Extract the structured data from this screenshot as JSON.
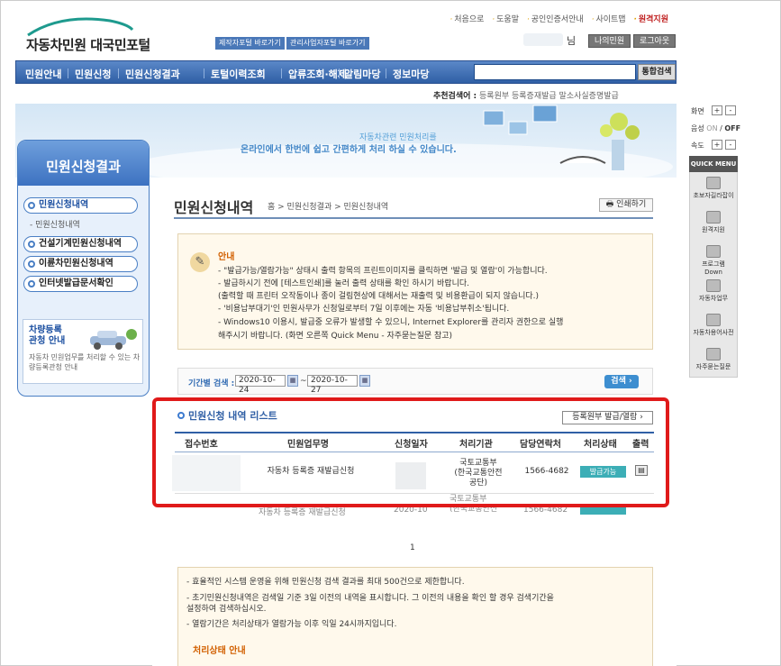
{
  "header": {
    "logo_text": "자동차민원 대국민포털",
    "portal_links": [
      "제작자포털 바로가기",
      "관리사업자포털 바로가기"
    ],
    "top_links": [
      "처음으로",
      "도움말",
      "공인인증서안내",
      "사이트맵",
      "원격지원"
    ],
    "user_suffix": "님",
    "my_civil": "나의민원",
    "logout": "로그아웃"
  },
  "gnb": {
    "items": [
      "민원안내",
      "민원신청",
      "민원신청결과",
      "토털이력조회",
      "압류조회·해제",
      "알림마당",
      "정보마당"
    ],
    "search_button": "통합검색"
  },
  "recommend": {
    "label": "추천검색어 :",
    "terms": "등록원부  등록증재발급  말소사실증명발급"
  },
  "banner": {
    "line1": "자동차관련 민원처리를",
    "line2": "온라인에서 한번에 쉽고 간편하게 처리 하실 수 있습니다."
  },
  "sidebar": {
    "title": "민원신청결과",
    "items": [
      {
        "label": "민원신청내역"
      },
      {
        "label": "건설기계민원신청내역"
      },
      {
        "label": "이륜차민원신청내역"
      },
      {
        "label": "인터넷발급문서확인"
      }
    ],
    "sub_item": "- 민원신청내역",
    "promo_title": "차량등록\n관청 안내",
    "promo_desc": "자동차 민원업무를 처리할 수 있는 차량등록관청 안내"
  },
  "quick": {
    "size_label": "화면",
    "sound_label": "음성",
    "sound_on": "ON",
    "sound_off": "OFF",
    "speed_label": "속도",
    "plus": "+",
    "minus": "-",
    "head": "QUICK MENU",
    "items": [
      "초보자길라잡이",
      "원격지원",
      "프로그램 Down",
      "자동차업무",
      "자동차용어사전",
      "자주묻는질문"
    ]
  },
  "content": {
    "title": "민원신청내역",
    "breadcrumb": "홈 > 민원신청결과 > 민원신청내역",
    "print_button": "인쇄하기",
    "notice": {
      "heading": "안내",
      "lines": [
        "- \"발급가능/열람가능\" 상태시 출력 항목의 프린트이미지를 클릭하면 '발급 및 열람'이 가능합니다.",
        "- 발급하시기 전에 [테스트인쇄]를 눌러 출력 상태를 확인 하시기 바랍니다.",
        "  (출력할 때 프린터 오작동이나 종이 걸림현상에 대해서는 재출력 및 비용환급이 되지 않습니다.)",
        "- '비용납부대기'인 민원사무가 신청일로부터 7일 이후에는 자동 '비용납부취소'됩니다.",
        "- Windows10 이용시, 발급중 오류가 발생할 수 있으니, Internet Explorer를 관리자 권한으로 실행",
        "  해주시기 바랍니다. (화면 오른쪽 Quick Menu - 자주묻는질문 참고)"
      ]
    },
    "filter": {
      "label": "기간별 검색 :",
      "from": "2020-10-24",
      "to": "2020-10-27",
      "tilde": "~",
      "search": "검색"
    },
    "list": {
      "heading": "민원신청 내역 리스트",
      "register_button": "등록원부 발급/열람",
      "columns": [
        "접수번호",
        "민원업무명",
        "신청일자",
        "처리기관",
        "담당연락처",
        "처리상태",
        "출력"
      ],
      "row": {
        "task": "자동차 등록증 재발급신청",
        "agency": "국토교통부\n(한국교통안전\n공단)",
        "phone": "1566-4682",
        "status": "발급가능"
      },
      "ghost_row": {
        "task": "자동차 등록증 재발급신청",
        "date": "2020-10",
        "agency": "국토교통부\n(한국교통안전",
        "phone": "1566-4682"
      }
    },
    "page": "1",
    "info": {
      "lines": [
        "- 효율적인 시스템 운영을 위해 민원신청 검색 결과를 최대 500건으로 제한합니다.",
        "- 초기민원신청내역은 검색일 기준 3일 이전의 내역을 표시합니다. 그 이전의 내용을 확인 할 경우 검색기간을",
        "  설정하여 검색하십시오.",
        "- 열람기간은 처리상태가 열람가능 이후 익일 24시까지입니다."
      ],
      "heading": "처리상태 안내"
    }
  }
}
